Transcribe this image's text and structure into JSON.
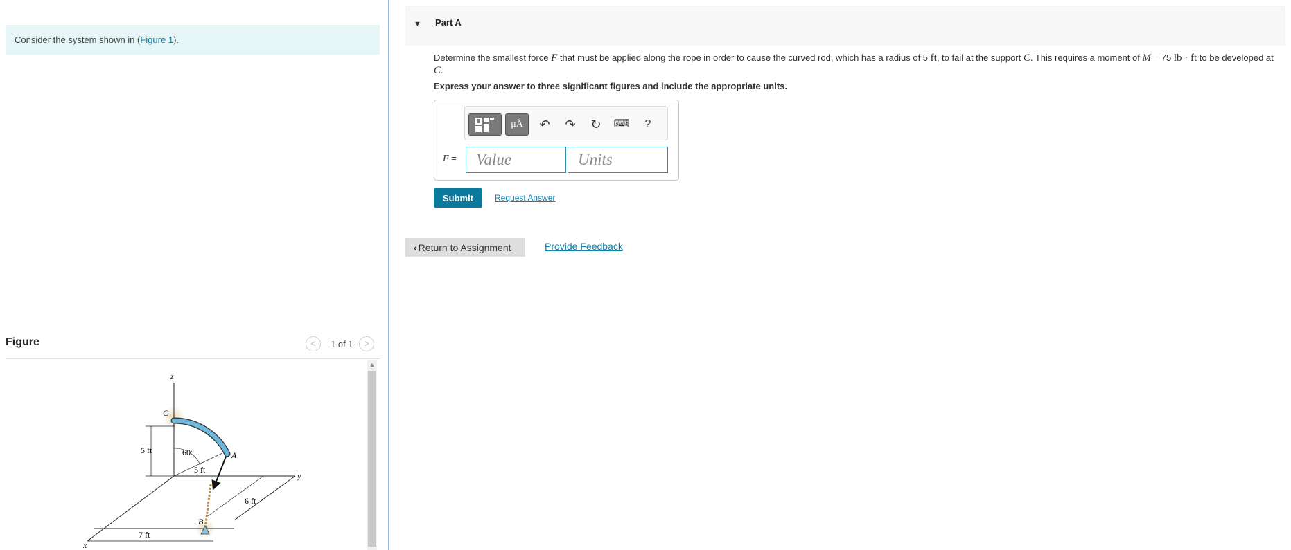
{
  "intro": {
    "text_before": "Consider the system shown in (",
    "figure_link": "Figure 1",
    "text_after": ")."
  },
  "figure_panel": {
    "title": "Figure",
    "pager": "1 of 1",
    "prev_icon": "chevron-left-icon",
    "next_icon": "chevron-right-icon",
    "labels": {
      "z": "z",
      "y": "y",
      "x": "x",
      "c": "C",
      "a": "A",
      "b": "B",
      "dim_5ft_vertical": "5 ft",
      "angle": "60°",
      "dim_5ft_radius": "5 ft",
      "dim_6ft": "6 ft",
      "dim_7ft": "7 ft"
    }
  },
  "part": {
    "title": "Part A",
    "question": {
      "t1": "Determine the smallest force ",
      "F": "F",
      "t2": " that must be applied along the rope in order to cause the curved rod, which has a radius of 5 ",
      "ft": "ft",
      "t3": ", to fail at the support ",
      "C": "C",
      "t4": ". This requires a moment of ",
      "M": "M",
      "t5": " = 75 ",
      "lbft": "lb · ft",
      "t6": " to be developed at ",
      "C2": "C",
      "t7": "."
    },
    "instruction": "Express your answer to three significant figures and include the appropriate units.",
    "toolbar": {
      "templates_icon": "templates-icon",
      "units_label": "μÅ",
      "undo_icon": "↶",
      "redo_icon": "↷",
      "reset_icon": "↻",
      "keyboard_icon": "⌨",
      "help_label": "?"
    },
    "answer": {
      "var": "F",
      "eq": " =",
      "value_placeholder": "Value",
      "units_placeholder": "Units"
    },
    "submit_label": "Submit",
    "request_answer_label": "Request Answer"
  },
  "footer": {
    "return_label": "Return to Assignment",
    "feedback_label": "Provide Feedback"
  },
  "colors": {
    "accent": "#0b7a9c",
    "link": "#0f7fa8",
    "intro_bg": "#e6f5f5",
    "rod": "#6fb6db"
  }
}
